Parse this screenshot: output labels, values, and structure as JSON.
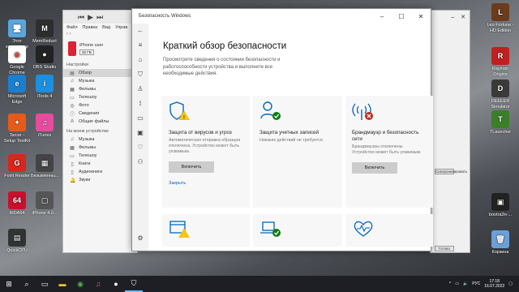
{
  "desktop_left": [
    {
      "label": "Этот компьютер",
      "color": "#5aa7e0",
      "glyph": "🖥"
    },
    {
      "label": "MemReduct",
      "color": "#2d2d2d",
      "glyph": "M"
    },
    {
      "label": "Google Chrome",
      "color": "#ffffff",
      "glyph": "◉"
    },
    {
      "label": "OBS Studio",
      "color": "#222222",
      "glyph": "●"
    },
    {
      "label": "Microsoft Edge",
      "color": "#1a7fd0",
      "glyph": "e"
    },
    {
      "label": "iTools 4",
      "color": "#1b8fe0",
      "glyph": "i"
    },
    {
      "label": "Tarcer - Setup ToolKit",
      "color": "#e85a1a",
      "glyph": "✦"
    },
    {
      "label": "iTunes",
      "color": "#e64b9d",
      "glyph": "♫"
    },
    {
      "label": "Foxit Reader",
      "color": "#d9261c",
      "glyph": "G"
    },
    {
      "label": "Безымянны...",
      "color": "#444444",
      "glyph": "▦"
    },
    {
      "label": "AIDA64",
      "color": "#c8102e",
      "glyph": "64"
    },
    {
      "label": "iPhone 4.0...",
      "color": "#555555",
      "glyph": "▢"
    },
    {
      "label": "QuickCPU",
      "color": "#333333",
      "glyph": "▤"
    }
  ],
  "desktop_right": [
    {
      "label": "Leo Fortune - HD Edition",
      "color": "#6b3b1e",
      "glyph": "L"
    },
    {
      "label": "Rayman Origins",
      "color": "#c02020",
      "glyph": "R"
    },
    {
      "label": "DEEEER Simulator",
      "color": "#3a3a3a",
      "glyph": "D"
    },
    {
      "label": "TLauncher",
      "color": "#3b7f2a",
      "glyph": "T"
    },
    {
      "label": "bootra3n-...",
      "color": "#222222",
      "glyph": "▣"
    },
    {
      "label": "Корзина",
      "color": "#6aa0d8",
      "glyph": "🗑"
    }
  ],
  "itunes": {
    "menu": [
      "Файл",
      "Правка",
      "Вид",
      "Управ"
    ],
    "device_name": "iPhone user",
    "device_cap": "32 ГБ",
    "settings_header": "Настройки",
    "settings_items": [
      {
        "label": "Обзор",
        "glyph": "▤",
        "selected": true
      },
      {
        "label": "Музыка",
        "glyph": "♫"
      },
      {
        "label": "Фильмы",
        "glyph": "▦"
      },
      {
        "label": "Телешоу",
        "glyph": "▭"
      },
      {
        "label": "Фото",
        "glyph": "◎"
      },
      {
        "label": "Сведения",
        "glyph": "ⓘ"
      },
      {
        "label": "Общие файлы",
        "glyph": "A"
      }
    ],
    "device_header": "На моем устройстве",
    "device_items": [
      {
        "label": "Музыка",
        "glyph": "♫"
      },
      {
        "label": "Фильмы",
        "glyph": "▦"
      },
      {
        "label": "Телешоу",
        "glyph": "▭"
      },
      {
        "label": "Книги",
        "glyph": "▯"
      },
      {
        "label": "Аудиокниги",
        "glyph": "▯"
      },
      {
        "label": "Звуки",
        "glyph": "🔔"
      }
    ]
  },
  "security": {
    "title": "Безопасность Windows",
    "heading": "Краткий обзор безопасности",
    "description": "Просмотрите сведения о состоянии безопасности и работоспособности устройства и выполните все необходимые действия.",
    "tiles": [
      {
        "title": "Защита от вирусов и угроз",
        "status": "Автоматическая отправка образцов отключена. Устройство может быть уязвимым.",
        "action": "Включить",
        "link": "Закрыть",
        "icon": "shield-warning-icon"
      },
      {
        "title": "Защита учетных записей",
        "status": "Никаких действий не требуется.",
        "icon": "person-check-icon"
      },
      {
        "title": "Брандмауэр и безопасность сети",
        "status": "Брандмауэры отключены. Устройство может быть уязвимым.",
        "action": "Включить",
        "icon": "antenna-error-icon"
      }
    ]
  },
  "bg_window": {
    "buttons": [
      "Синхронизировать",
      "Готово"
    ]
  },
  "taskbar": {
    "lang": "РУС",
    "time": "17:18",
    "date": "16.07.2022"
  }
}
